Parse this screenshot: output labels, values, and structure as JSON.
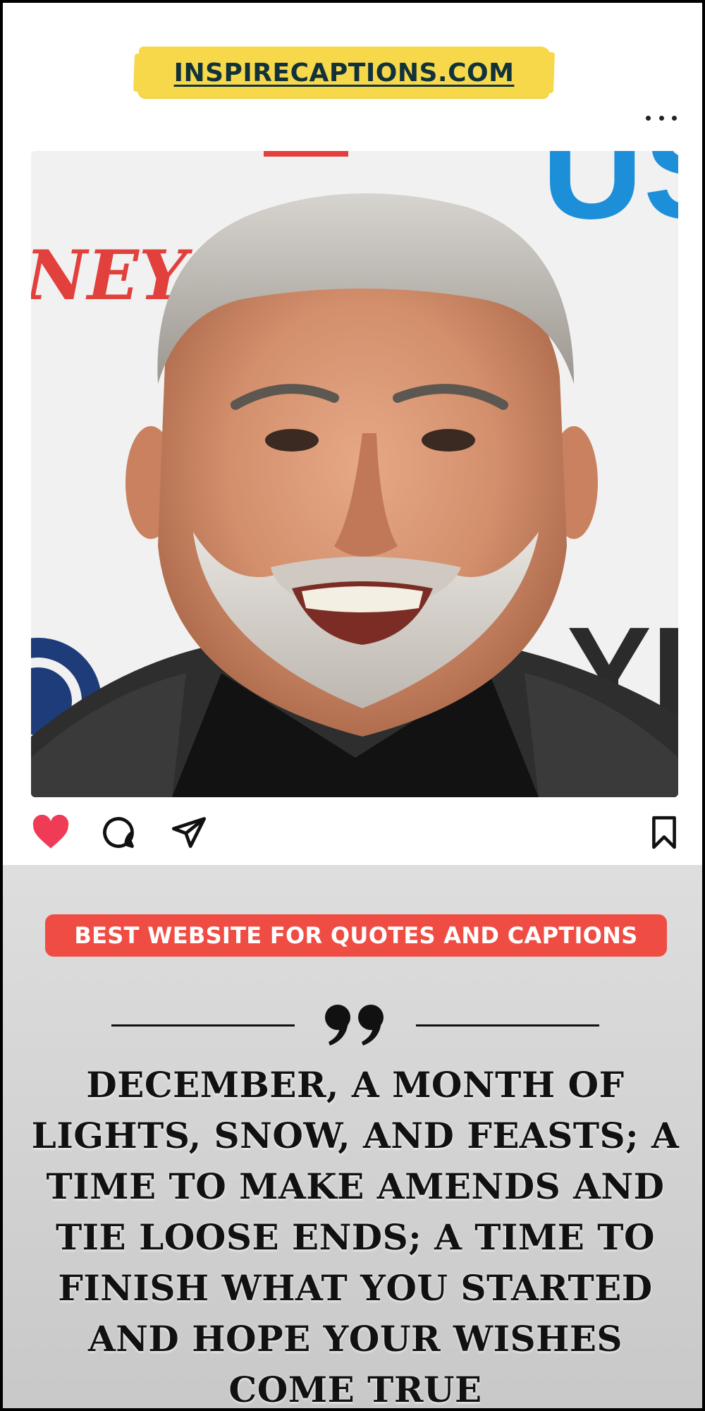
{
  "brand": {
    "text": "INSPIRECAPTIONS.COM",
    "highlight_color": "#f6d84a",
    "text_color": "#11323a"
  },
  "post": {
    "more_icon": "more-horizontal-icon",
    "photo": {
      "subject": "smiling man with gray hair and beard",
      "backdrop_text": {
        "left": "NEY",
        "top_right": "US",
        "bottom_right": "YP"
      }
    },
    "actions": {
      "like_icon": "heart-filled-icon",
      "comment_icon": "comment-bubble-icon",
      "share_icon": "send-paper-plane-icon",
      "save_icon": "bookmark-icon",
      "like_color": "#ef3b56"
    }
  },
  "banner": {
    "text": "BEST WEBSITE FOR QUOTES AND CAPTIONS",
    "color": "#ef4d44"
  },
  "quote": {
    "icon": "quotation-mark-icon",
    "text": "December, a month of lights, snow, and feasts; a time to make amends and tie loose ends; a time to finish what you started and hope your wishes come true"
  }
}
